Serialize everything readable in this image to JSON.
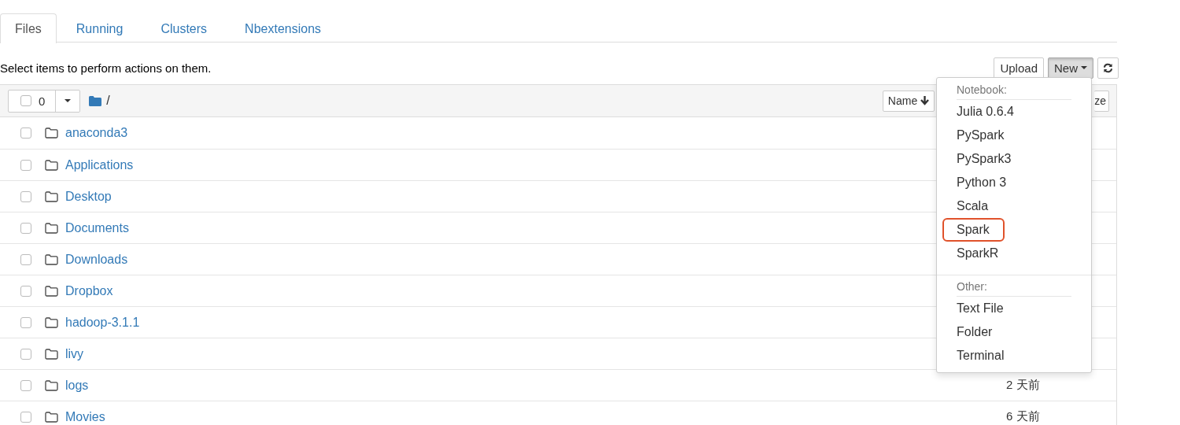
{
  "tabs": [
    {
      "label": "Files",
      "selected": true
    },
    {
      "label": "Running",
      "selected": false
    },
    {
      "label": "Clusters",
      "selected": false
    },
    {
      "label": "Nbextensions",
      "selected": false
    }
  ],
  "toolbar": {
    "hint": "Select items to perform actions on them.",
    "buttons": [
      {
        "kind": "text",
        "label": "Upload",
        "active": false
      },
      {
        "kind": "menu",
        "label": "New",
        "active": true
      },
      {
        "kind": "refresh",
        "active": false
      }
    ]
  },
  "list_header": {
    "select_all_checked": false,
    "selected_count": "0",
    "path": "/",
    "sort_buttons": [
      "Name",
      "ze"
    ]
  },
  "rows": [
    {
      "name": "anaconda3",
      "checked": false,
      "modified": ""
    },
    {
      "name": "Applications",
      "checked": false,
      "modified": ""
    },
    {
      "name": "Desktop",
      "checked": false,
      "modified": ""
    },
    {
      "name": "Documents",
      "checked": false,
      "modified": ""
    },
    {
      "name": "Downloads",
      "checked": false,
      "modified": ""
    },
    {
      "name": "Dropbox",
      "checked": false,
      "modified": ""
    },
    {
      "name": "hadoop-3.1.1",
      "checked": false,
      "modified": ""
    },
    {
      "name": "livy",
      "checked": false,
      "modified": ""
    },
    {
      "name": "logs",
      "checked": false,
      "modified": "2 天前"
    },
    {
      "name": "Movies",
      "checked": false,
      "modified": "6 天前"
    }
  ],
  "new_menu": {
    "sections": [
      {
        "header": "Notebook:",
        "items": [
          {
            "label": "Julia 0.6.4",
            "highlighted": false
          },
          {
            "label": "PySpark",
            "highlighted": false
          },
          {
            "label": "PySpark3",
            "highlighted": false
          },
          {
            "label": "Python 3",
            "highlighted": false
          },
          {
            "label": "Scala",
            "highlighted": false
          },
          {
            "label": "Spark",
            "highlighted": true
          },
          {
            "label": "SparkR",
            "highlighted": false
          }
        ]
      },
      {
        "header": "Other:",
        "items": [
          {
            "label": "Text File",
            "highlighted": false
          },
          {
            "label": "Folder",
            "highlighted": false
          },
          {
            "label": "Terminal",
            "highlighted": false
          }
        ]
      }
    ]
  }
}
